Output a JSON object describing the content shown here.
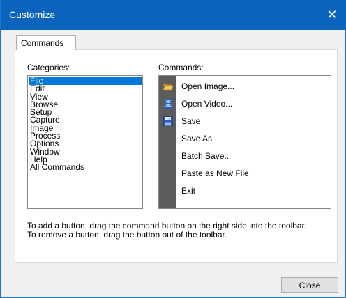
{
  "window": {
    "title": "Customize",
    "close_glyph": "✕"
  },
  "tabs": [
    {
      "label": "Commands"
    }
  ],
  "categories": {
    "label": "Categories:",
    "items": [
      "File",
      "Edit",
      "View",
      "Browse",
      "Setup",
      "Capture",
      "Image",
      "Process",
      "Options",
      "Window",
      "Help",
      "All Commands"
    ],
    "selected": "File"
  },
  "commands": {
    "label": "Commands:",
    "items": [
      {
        "label": "Open Image...",
        "icon": "folder-open-icon"
      },
      {
        "label": "Open Video...",
        "icon": "film-icon"
      },
      {
        "label": "Save",
        "icon": "floppy-disk-icon"
      },
      {
        "label": "Save As...",
        "icon": ""
      },
      {
        "label": "Batch Save...",
        "icon": ""
      },
      {
        "label": "Paste as New File",
        "icon": ""
      },
      {
        "label": "Exit",
        "icon": ""
      }
    ]
  },
  "help": {
    "line1": "To add a button, drag the command button on the right side into the toolbar.",
    "line2": "To remove a button, drag the button out of the toolbar."
  },
  "buttons": {
    "close": "Close"
  },
  "colors": {
    "titlebar": "#0a64bd",
    "selection": "#0078d7",
    "icon_strip": "#5c5c5c"
  }
}
